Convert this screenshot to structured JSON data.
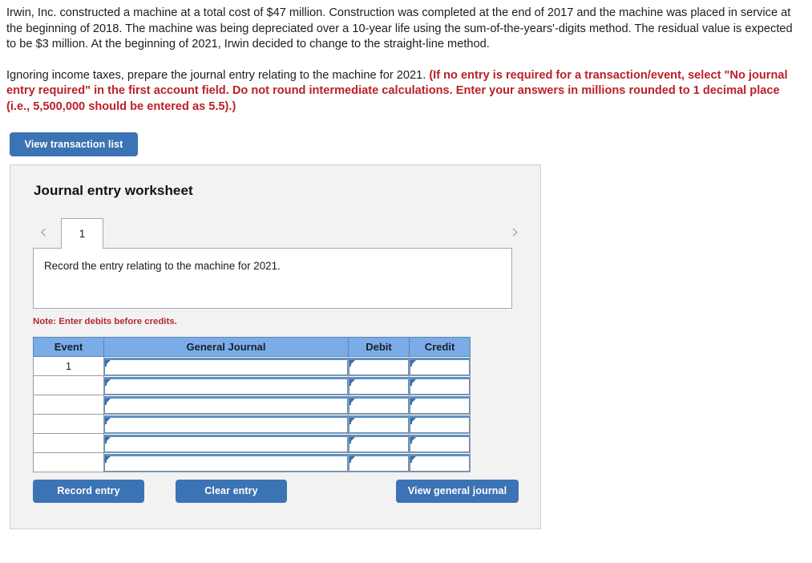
{
  "problem": {
    "paragraph1": "Irwin, Inc. constructed a machine at a total cost of $47 million. Construction was completed at the end of 2017 and the machine was placed in service at the beginning of 2018. The machine was being depreciated over a 10-year life using the sum-of-the-years'-digits method. The residual value is expected to be $3 million. At the beginning of 2021, Irwin decided to change to the straight-line method.",
    "paragraph2_plain": "Ignoring income taxes, prepare the journal entry relating to the machine for 2021. ",
    "paragraph2_emphasis": "(If no entry is required for a transaction/event, select \"No journal entry required\" in the first account field. Do not round intermediate calculations. Enter your answers in millions rounded to 1 decimal place (i.e., 5,500,000 should be entered as 5.5).)"
  },
  "toolbar": {
    "view_transaction_list_label": "View transaction list"
  },
  "worksheet": {
    "title": "Journal entry worksheet",
    "prev_icon": "chevron-left-icon",
    "next_icon": "chevron-right-icon",
    "tabs": [
      {
        "label": "1",
        "active": true
      }
    ],
    "description": "Record the entry relating to the machine for 2021.",
    "note": "Note: Enter debits before credits.",
    "table": {
      "headers": [
        "Event",
        "General Journal",
        "Debit",
        "Credit"
      ],
      "rows": [
        {
          "event": "1",
          "general_journal": "",
          "debit": "",
          "credit": ""
        },
        {
          "event": "",
          "general_journal": "",
          "debit": "",
          "credit": ""
        },
        {
          "event": "",
          "general_journal": "",
          "debit": "",
          "credit": ""
        },
        {
          "event": "",
          "general_journal": "",
          "debit": "",
          "credit": ""
        },
        {
          "event": "",
          "general_journal": "",
          "debit": "",
          "credit": ""
        },
        {
          "event": "",
          "general_journal": "",
          "debit": "",
          "credit": ""
        }
      ]
    },
    "buttons": {
      "record_entry_label": "Record entry",
      "clear_entry_label": "Clear entry",
      "view_general_journal_label": "View general journal"
    }
  },
  "colors": {
    "button_blue": "#3c73b4",
    "table_header_blue": "#7bace8",
    "input_border_blue": "#5f8fc4",
    "emphasis_red": "#bb2127",
    "panel_background": "#f2f2f2"
  }
}
